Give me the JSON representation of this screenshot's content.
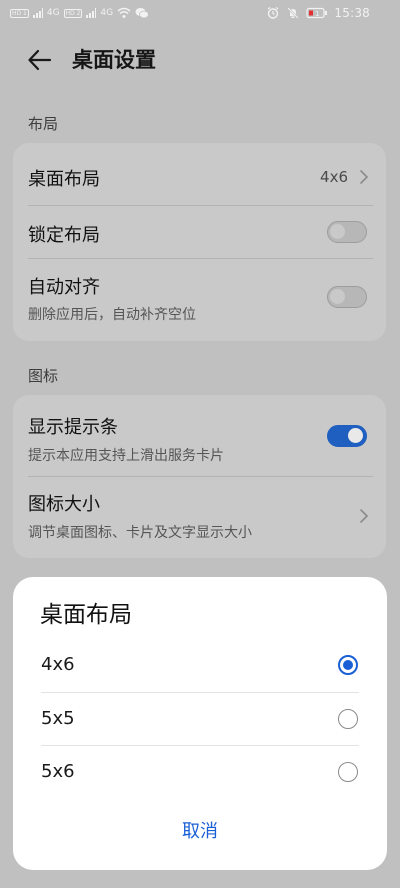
{
  "status_bar": {
    "time": "15:38",
    "hd1": "HD 1",
    "hd2": "HD 2",
    "net1": "4G",
    "net2": "4G",
    "icons": [
      "alarm-icon",
      "mute-icon",
      "battery-low-icon",
      "wifi-icon",
      "wechat-icon"
    ]
  },
  "header": {
    "title": "桌面设置",
    "back_icon": "arrow-left-icon"
  },
  "layout_section": {
    "label": "布局",
    "rows": {
      "desktop_layout": {
        "title": "桌面布局",
        "value": "4x6"
      },
      "lock_layout": {
        "title": "锁定布局",
        "enabled": false
      },
      "auto_align": {
        "title": "自动对齐",
        "subtitle": "删除应用后，自动补齐空位",
        "enabled": false
      }
    }
  },
  "icon_section": {
    "label": "图标",
    "rows": {
      "show_hint_bar": {
        "title": "显示提示条",
        "subtitle": "提示本应用支持上滑出服务卡片",
        "enabled": true
      },
      "icon_size": {
        "title": "图标大小",
        "subtitle": "调节桌面图标、卡片及文字显示大小"
      }
    }
  },
  "dialog": {
    "title": "桌面布局",
    "options": [
      {
        "label": "4x6",
        "selected": true
      },
      {
        "label": "5x5",
        "selected": false
      },
      {
        "label": "5x6",
        "selected": false
      }
    ],
    "cancel_label": "取消"
  },
  "colors": {
    "accent": "#1a5fd6",
    "toggle_on": "#1f5fbf",
    "scrim_background": "#c0c0c0",
    "card_background": "#c9c9c9",
    "dialog_background": "#ffffff"
  }
}
